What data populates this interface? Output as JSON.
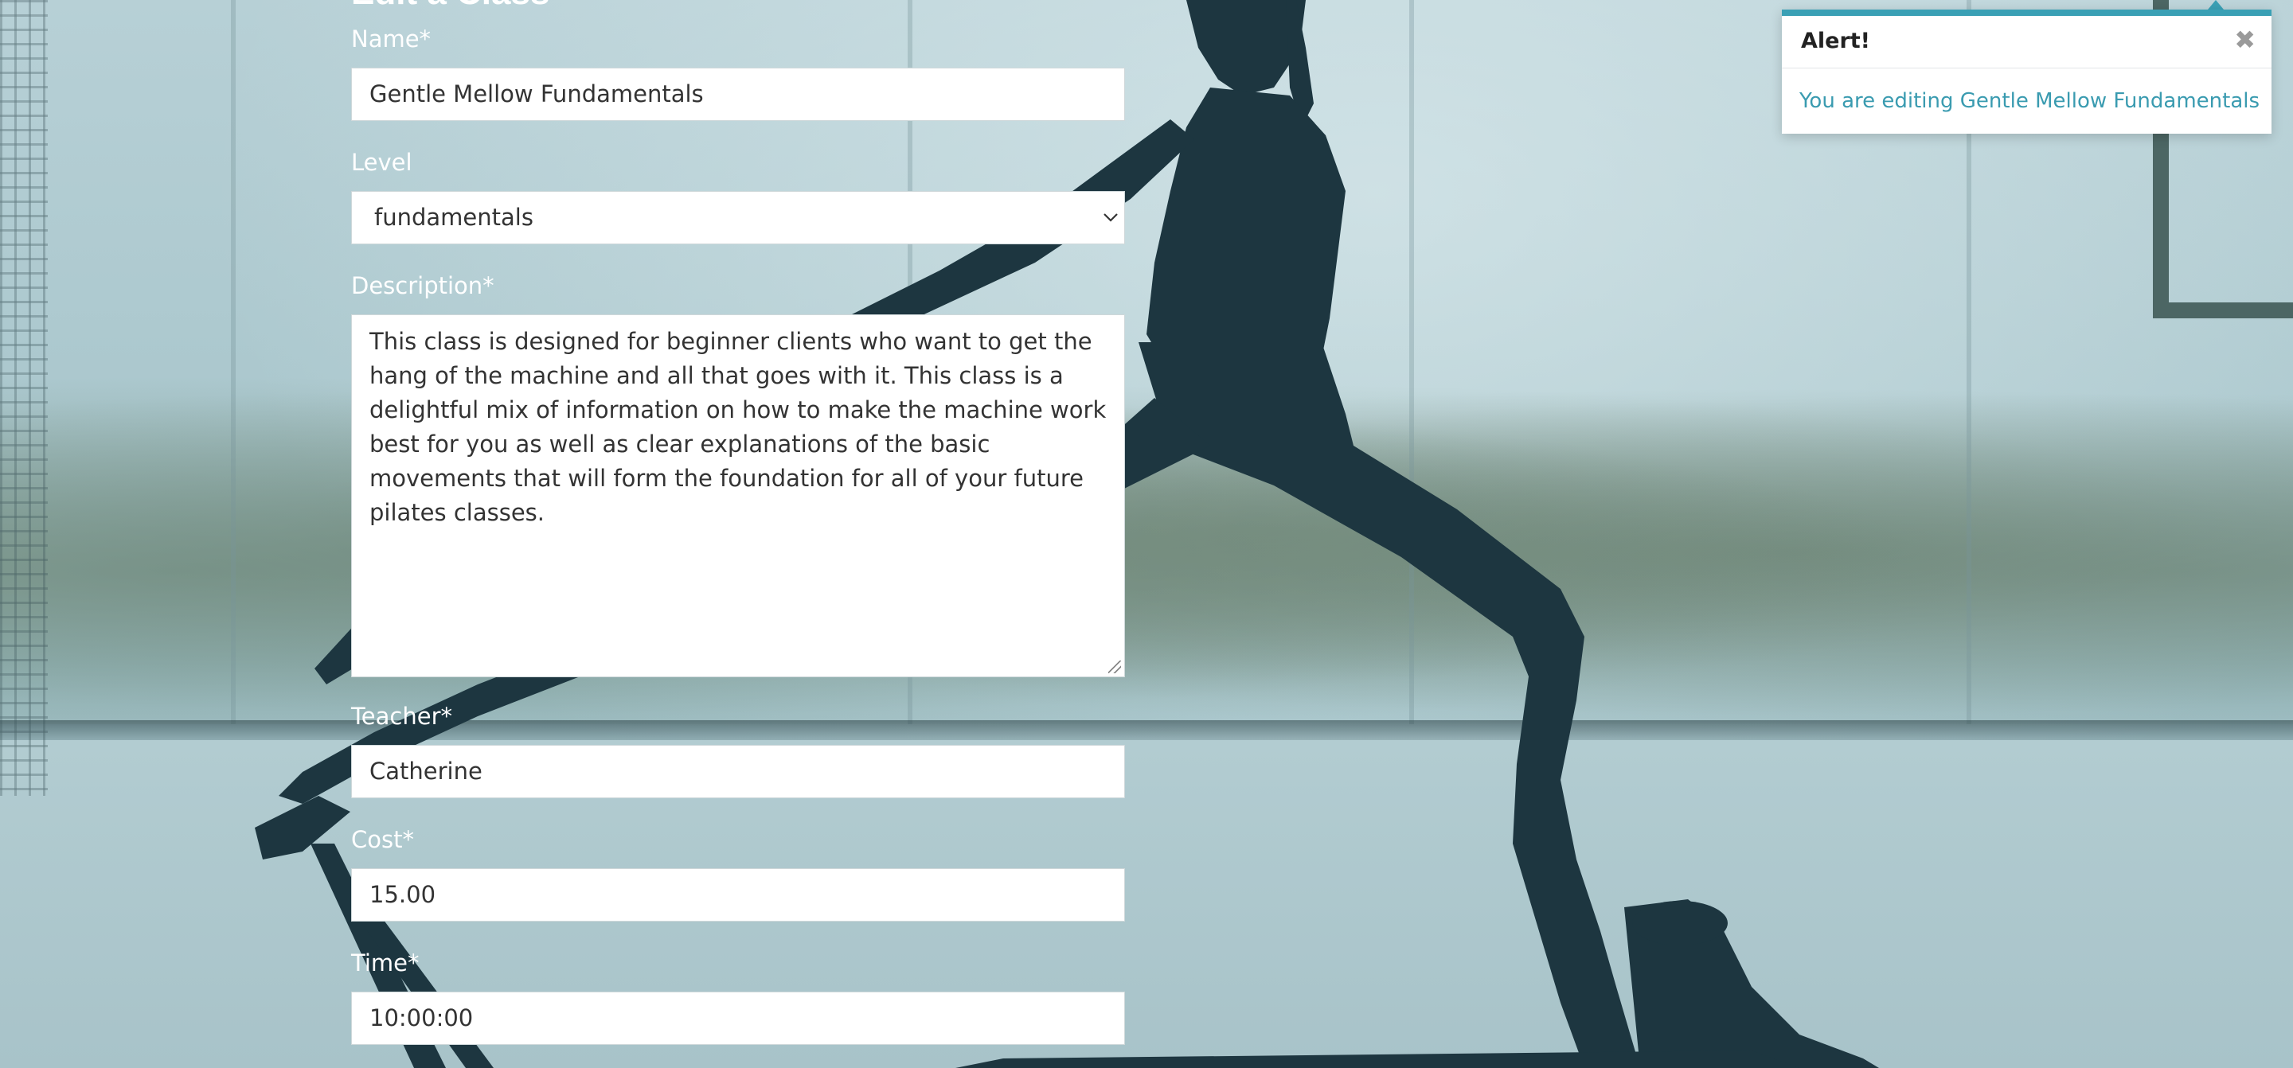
{
  "page": {
    "heading": "Edit a Class"
  },
  "form": {
    "name": {
      "label": "Name*",
      "value": "Gentle Mellow Fundamentals"
    },
    "level": {
      "label": "Level",
      "selected": "fundamentals"
    },
    "description": {
      "label": "Description*",
      "value": "This class is designed for beginner clients who want to get the hang of the machine and all that goes with it. This class is a delightful mix of information on how to make the machine work best for you as well as clear explanations of the basic movements that will form the foundation for all of your future pilates classes."
    },
    "teacher": {
      "label": "Teacher*",
      "value": "Catherine"
    },
    "cost": {
      "label": "Cost*",
      "value": "15.00"
    },
    "time": {
      "label": "Time*",
      "value": "10:00:00"
    }
  },
  "alert": {
    "title": "Alert!",
    "close_glyph": "✖",
    "message": "You are editing Gentle Mellow Fundamentals"
  },
  "colors": {
    "accent": "#3aa0b5",
    "label_text": "#ffffff",
    "silhouette": "#1d3640"
  },
  "icons": {
    "select_arrow": "chevron-down-icon",
    "alert_close": "close-icon"
  }
}
